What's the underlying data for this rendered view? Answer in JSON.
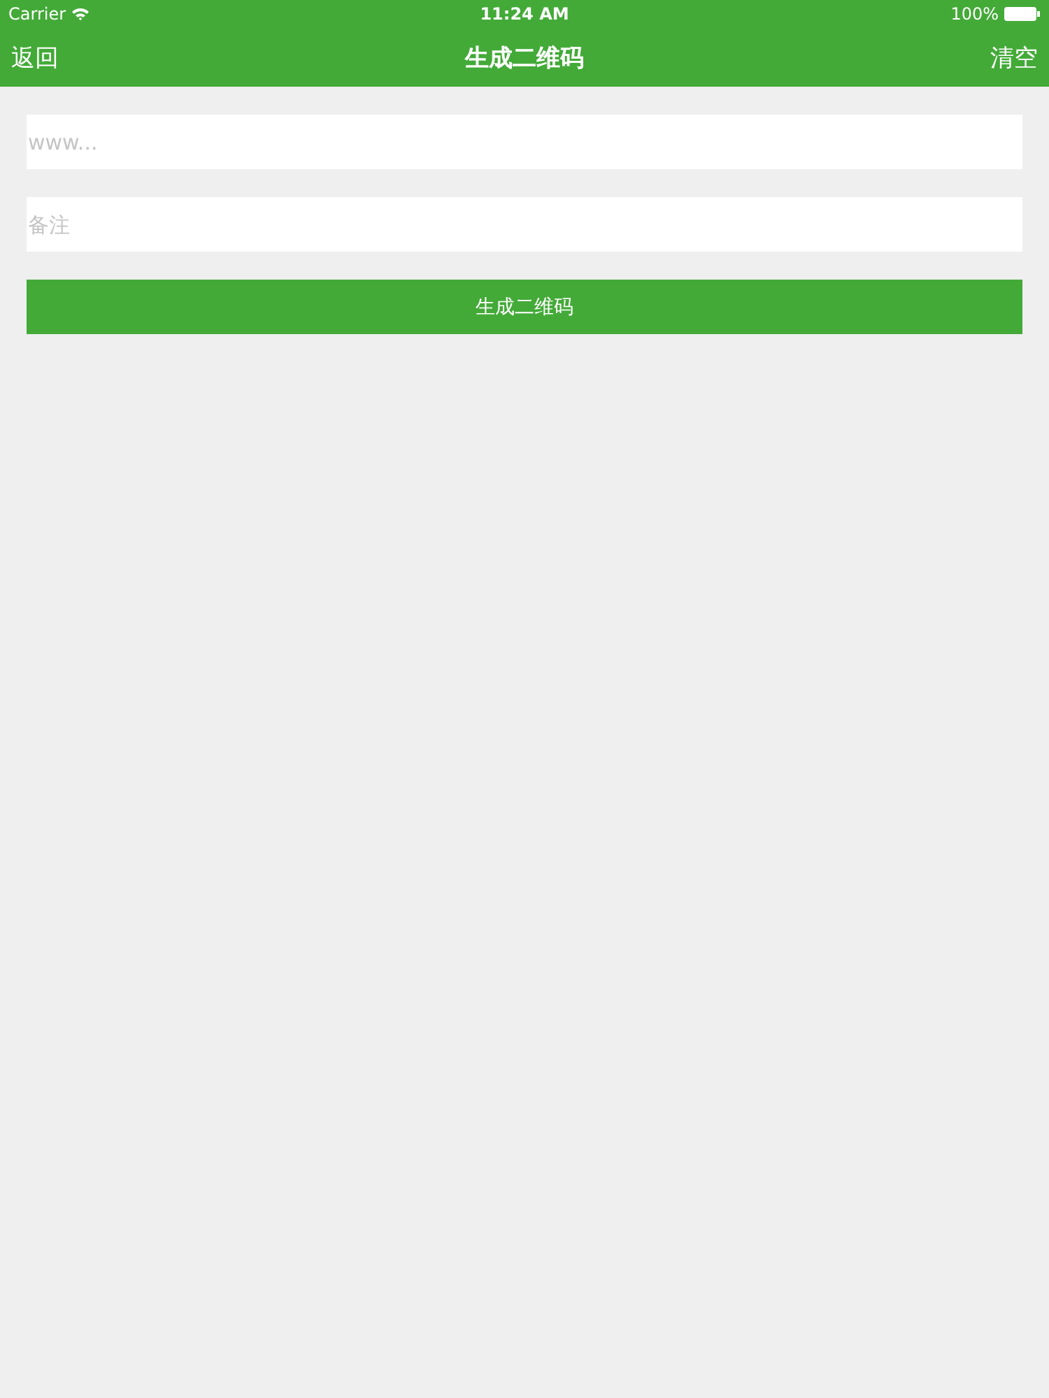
{
  "status_bar": {
    "carrier": "Carrier",
    "time": "11:24 AM",
    "battery": "100%"
  },
  "nav_bar": {
    "back": "返回",
    "title": "生成二维码",
    "clear": "清空"
  },
  "fields": [
    {
      "placeholder": "www..."
    },
    {
      "placeholder": "备注"
    }
  ],
  "generate_button": "生成二维码"
}
